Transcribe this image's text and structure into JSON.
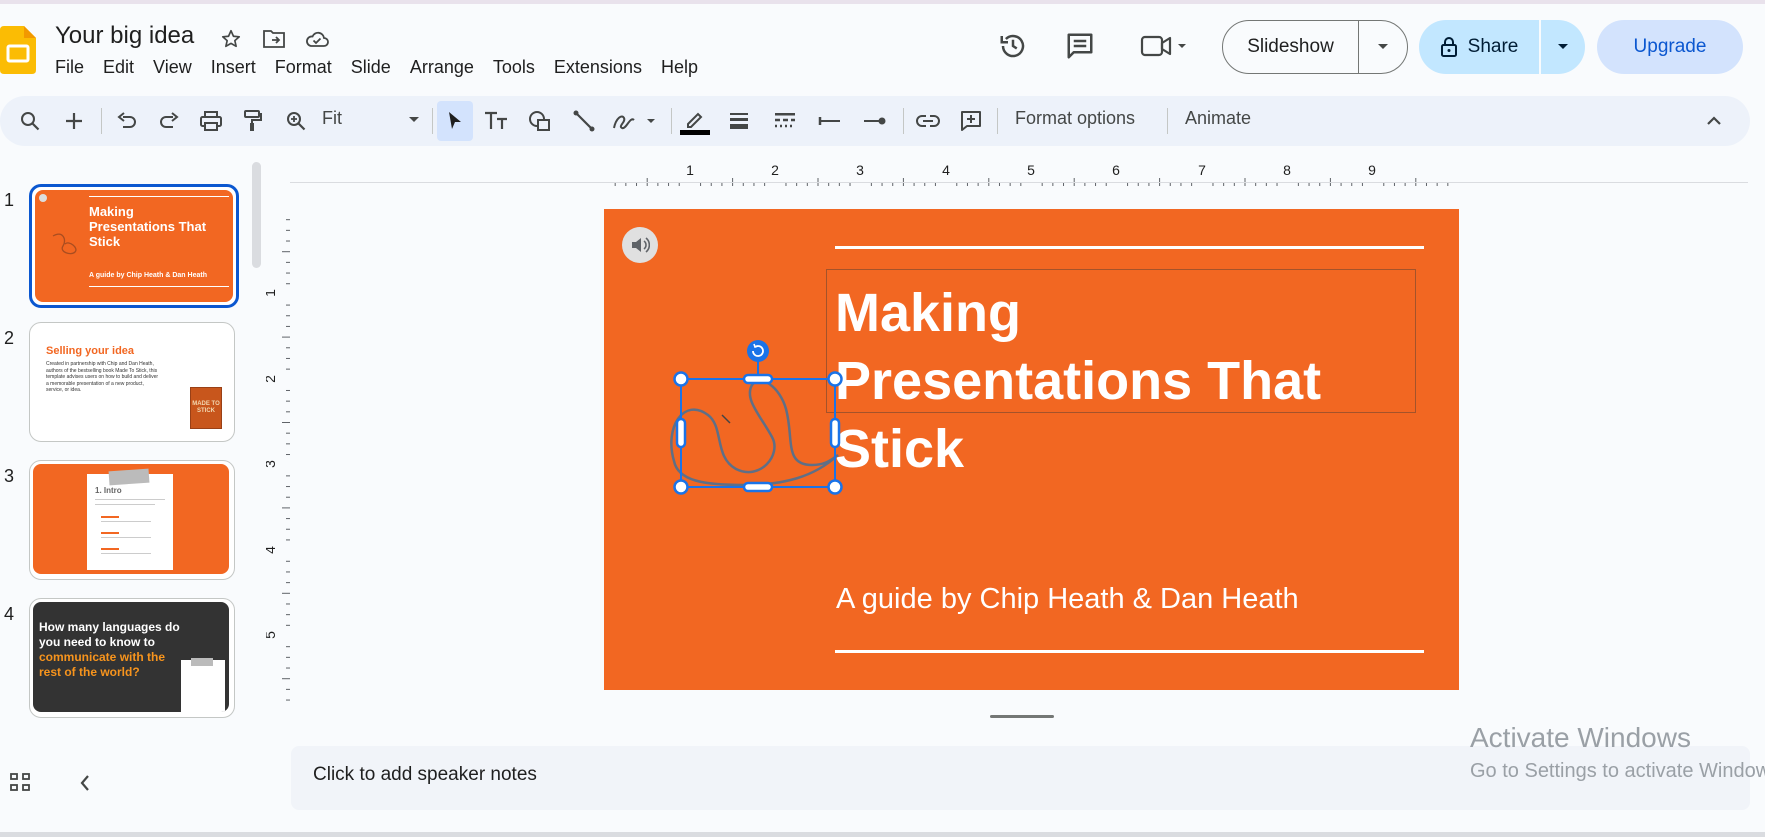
{
  "doc": {
    "title": "Your big idea"
  },
  "menu": [
    "File",
    "Edit",
    "View",
    "Insert",
    "Format",
    "Slide",
    "Arrange",
    "Tools",
    "Extensions",
    "Help"
  ],
  "header": {
    "slideshow_label": "Slideshow",
    "share_label": "Share",
    "upgrade_label": "Upgrade"
  },
  "toolbar": {
    "zoom_value": "Fit",
    "format_options_label": "Format options",
    "animate_label": "Animate"
  },
  "rulers": {
    "horizontal": [
      "1",
      "2",
      "3",
      "4",
      "5",
      "6",
      "7",
      "8",
      "9"
    ],
    "vertical": [
      "1",
      "2",
      "3",
      "4",
      "5"
    ]
  },
  "slides": [
    {
      "number": "1",
      "title": "Making Presentations That Stick",
      "subtitle": "A guide by Chip Heath & Dan Heath"
    },
    {
      "number": "2",
      "title": "Selling your idea",
      "body": "Created in partnership with Chip and Dan Heath, authors of the bestselling book Made To Stick, this template advises users on how to build and deliver a memorable presentation of a new product, service, or idea.",
      "book": "MADE TO STICK"
    },
    {
      "number": "3",
      "title": "1. Intro"
    },
    {
      "number": "4",
      "line1": "How many languages do you need to know to",
      "line2": "communicate with the rest of the world?"
    }
  ],
  "current_slide": {
    "title_lines": [
      "Making",
      "Presentations That",
      "Stick"
    ],
    "subtitle": "A guide by Chip Heath & Dan Heath"
  },
  "notes": {
    "placeholder": "Click to add speaker notes"
  },
  "watermark": {
    "line1": "Activate Windows",
    "line2": "Go to Settings to activate Windows."
  },
  "colors": {
    "slide_orange": "#f26722",
    "accent_blue": "#0b57d0",
    "share_bg": "#c2e7ff",
    "upgrade_bg": "#d3e3fd",
    "dark_slide": "#333333"
  }
}
